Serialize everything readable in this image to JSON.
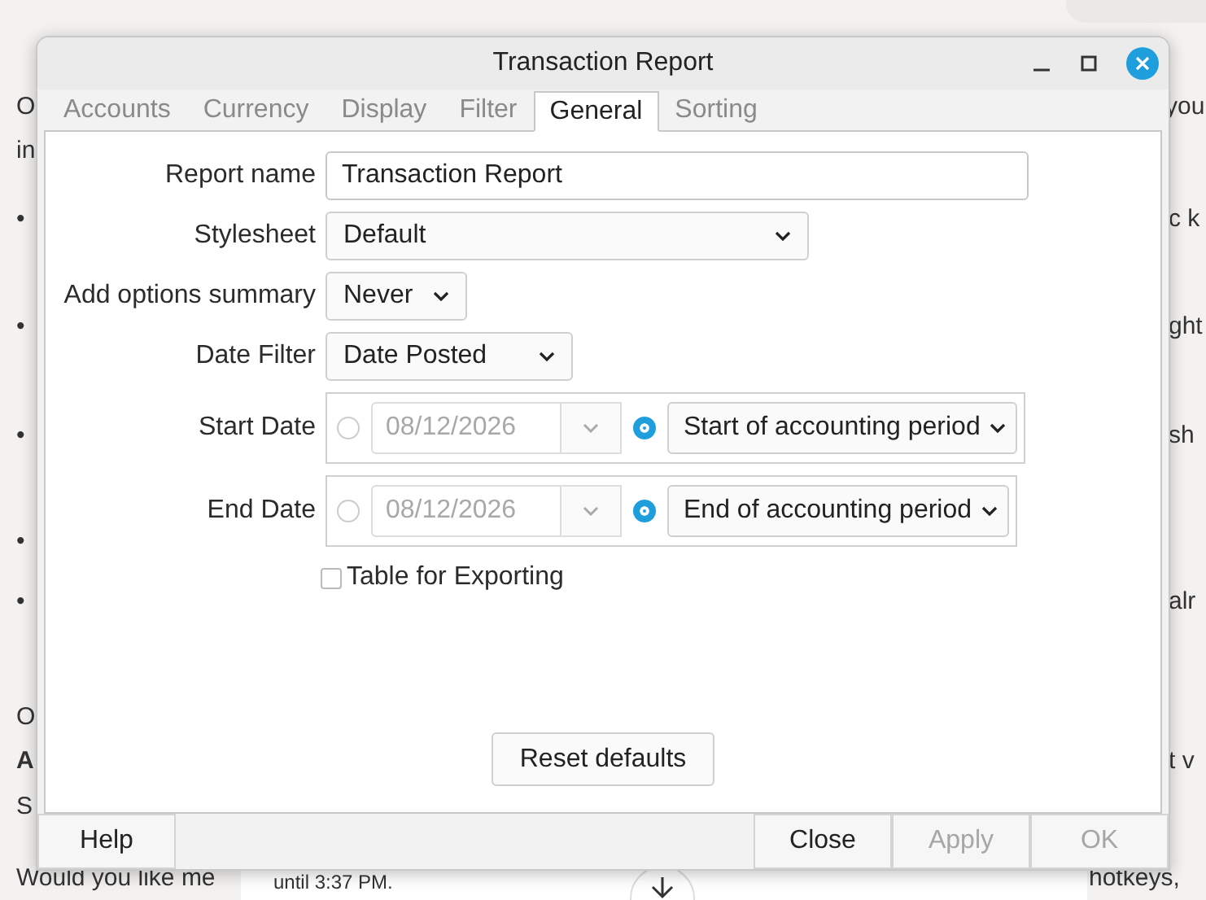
{
  "background": {
    "left": [
      {
        "text": "O",
        "bold": false
      },
      {
        "text": "in",
        "bold": false
      },
      {
        "text": "•",
        "bold": false
      },
      {
        "text": "•",
        "bold": false
      },
      {
        "text": "•",
        "bold": false
      },
      {
        "text": "•",
        "bold": false
      },
      {
        "text": "•",
        "bold": false
      },
      {
        "text": "O",
        "bold": false
      },
      {
        "text": "A",
        "bold": true
      },
      {
        "text": "S",
        "bold": false
      },
      {
        "text": "Would you like me",
        "bold": false
      }
    ],
    "right": [
      {
        "text": "you",
        "bold": false
      },
      {
        "text": "c k",
        "bold": false
      },
      {
        "text": "ght",
        "bold": false
      },
      {
        "text": "sh",
        "bold": false
      },
      {
        "text": "alr",
        "bold": false
      },
      {
        "text": "t v",
        "bold": false
      },
      {
        "text": "hotkeys,",
        "bold": false
      }
    ],
    "notice": "until 3:37 PM."
  },
  "window": {
    "title": "Transaction Report"
  },
  "tabs": [
    {
      "label": "Accounts",
      "selected": false
    },
    {
      "label": "Currency",
      "selected": false
    },
    {
      "label": "Display",
      "selected": false
    },
    {
      "label": "Filter",
      "selected": false
    },
    {
      "label": "General",
      "selected": true
    },
    {
      "label": "Sorting",
      "selected": false
    }
  ],
  "options": [
    {
      "kind": "text",
      "label": "Report name",
      "value": "Transaction Report"
    },
    {
      "kind": "combo",
      "label": "Stylesheet",
      "value": "Default"
    },
    {
      "kind": "combo",
      "label": "Add options summary",
      "value": "Never"
    },
    {
      "kind": "combo",
      "label": "Date Filter",
      "value": "Date Posted"
    },
    {
      "kind": "date",
      "label": "Start Date",
      "absolute_selected": false,
      "date": "08/12/2026",
      "relative_selected": true,
      "relative": "Start of accounting period"
    },
    {
      "kind": "date",
      "label": "End Date",
      "absolute_selected": false,
      "date": "08/12/2026",
      "relative_selected": true,
      "relative": "End of accounting period"
    },
    {
      "kind": "checkbox",
      "label": "Table for Exporting",
      "checked": false
    }
  ],
  "reset_button": "Reset defaults",
  "footer": {
    "help": {
      "label": "Help",
      "disabled": false
    },
    "actions": [
      {
        "label": "Close",
        "disabled": false
      },
      {
        "label": "Apply",
        "disabled": true
      },
      {
        "label": "OK",
        "disabled": true
      }
    ]
  }
}
